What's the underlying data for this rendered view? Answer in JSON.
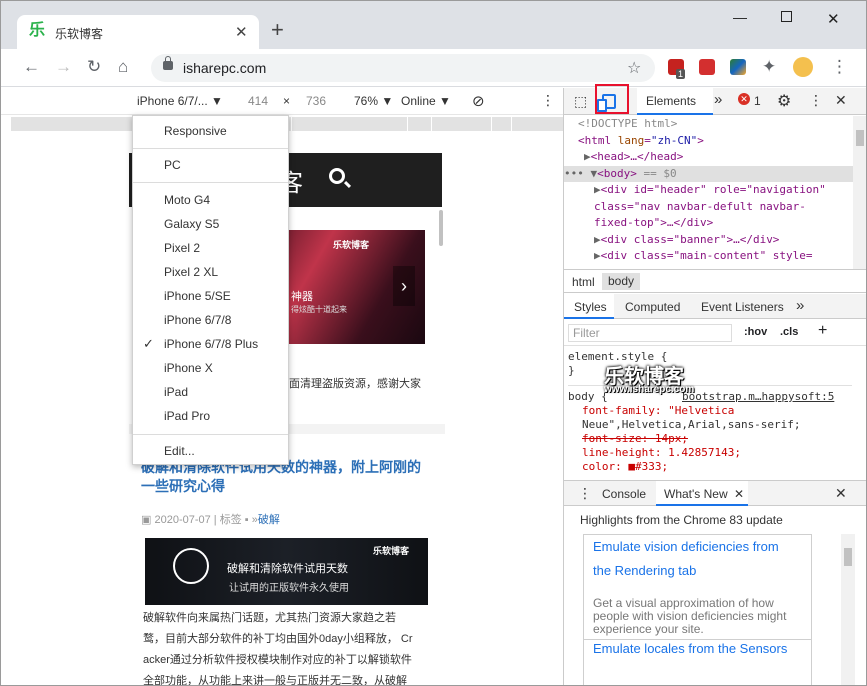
{
  "browser": {
    "tab_title": "乐软博客",
    "favicon_glyph": "乐",
    "new_tab": "+",
    "url": "isharepc.com",
    "badge_count": "1"
  },
  "device_toolbar": {
    "device": "iPhone 6/7/...",
    "width": "414",
    "times": "×",
    "height": "736",
    "zoom": "76%",
    "network": "Online"
  },
  "device_menu": {
    "responsive": "Responsive",
    "pc": "PC",
    "items": [
      "Moto G4",
      "Galaxy S5",
      "Pixel 2",
      "Pixel 2 XL",
      "iPhone 5/SE",
      "iPhone 6/7/8",
      "iPhone 6/7/8 Plus",
      "iPhone X",
      "iPad",
      "iPad Pro"
    ],
    "selected": "iPhone 6/7/8 Plus",
    "check": "✓",
    "edit": "Edit..."
  },
  "site": {
    "header_text": "客",
    "banner_logo": "乐软博客",
    "banner_title": "神器",
    "banner_sub": "得炫酷十道起来",
    "notice": "面清理盗版资源，感谢大家",
    "post_title": "破解和清除软件试用天数的神器，附上阿刚的一些研究心得",
    "post_date": "2020-07-07",
    "post_tag_label": "标签",
    "post_tag": "破解",
    "image_logo": "乐软博客",
    "image_title": "破解和清除软件试用天数",
    "image_sub": "让试用的正版软件永久使用",
    "body_lines": [
      "破解软件向来属热门话题，尤其热门资源大家趋之若",
      "鹜，目前大部分软件的补丁均由国外0day小组释放， Cr",
      "acker通过分析软件授权模块制作对应的补丁以解锁软件",
      "全部功能，从功能上来讲一般与正版并无二致，从破解"
    ]
  },
  "devtools": {
    "tab_elements": "Elements",
    "more_tabs": "»",
    "error_count": "1",
    "dom": {
      "doctype": "<!DOCTYPE html>",
      "html_open": "<html ",
      "html_attr": "lang",
      "html_val": "\"zh-CN\"",
      "head": "<head>…</head>",
      "body": "<body>",
      "body_eq": " == $0",
      "div_header": "<div id=\"header\" role=\"navigation\"",
      "div_header_cls": "class=\"nav navbar-defult navbar-",
      "div_header_end": "fixed-top\">…</div>",
      "div_banner": "<div class=\"banner\">…</div>",
      "div_main": "<div class=\"main-content\" style="
    },
    "crumb_html": "html",
    "crumb_body": "body",
    "styles_tabs": [
      "Styles",
      "Computed",
      "Event Listeners"
    ],
    "filter_placeholder": "Filter",
    "hov": ":hov",
    "cls": ".cls",
    "plus": "+",
    "element_style": "element.style {",
    "close_brace": "}",
    "body_rule": "body {",
    "source_link": "bootstrap.m…happysoft:5",
    "props": [
      "font-family: \"Helvetica",
      "  Neue\",Helvetica,Arial,sans-serif;",
      "font-size: 14px;",
      "line-height: 1.42857143;",
      "color: ■#333;"
    ],
    "watermark": "乐软博客",
    "watermark_url": "www.isharepc.com",
    "drawer_tabs": [
      "Console",
      "What's New"
    ],
    "highlight": "Highlights from the Chrome 83 update",
    "card1_title_1": "Emulate vision deficiencies from",
    "card1_title_2": "the Rendering tab",
    "card1_desc": "Get a visual approximation of how people with vision deficiencies might experience your site.",
    "card2_title": "Emulate locales from the Sensors"
  }
}
